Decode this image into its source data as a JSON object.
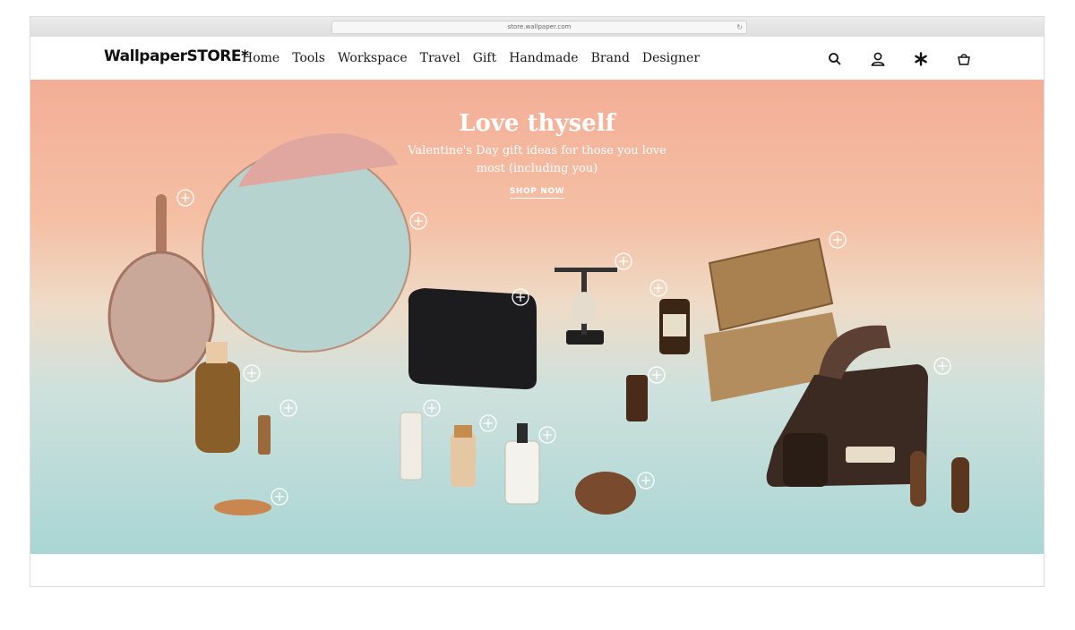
{
  "browser": {
    "url": "store.wallpaper.com"
  },
  "nav": {
    "logo": "WallpaperSTORE*",
    "items": [
      "Home",
      "Tools",
      "Workspace",
      "Travel",
      "Gift",
      "Handmade",
      "Brand",
      "Designer"
    ],
    "icons": [
      "search-icon",
      "account-icon",
      "star-icon",
      "basket-icon"
    ]
  },
  "hero": {
    "title": "Love thyself",
    "subtitle": "Valentine's Day gift ideas for those you love most (including you)",
    "cta": "SHOP NOW",
    "colors": {
      "top": "#f3ae96",
      "middle": "#eedcc8",
      "bottom": "#a9d6d4"
    }
  }
}
